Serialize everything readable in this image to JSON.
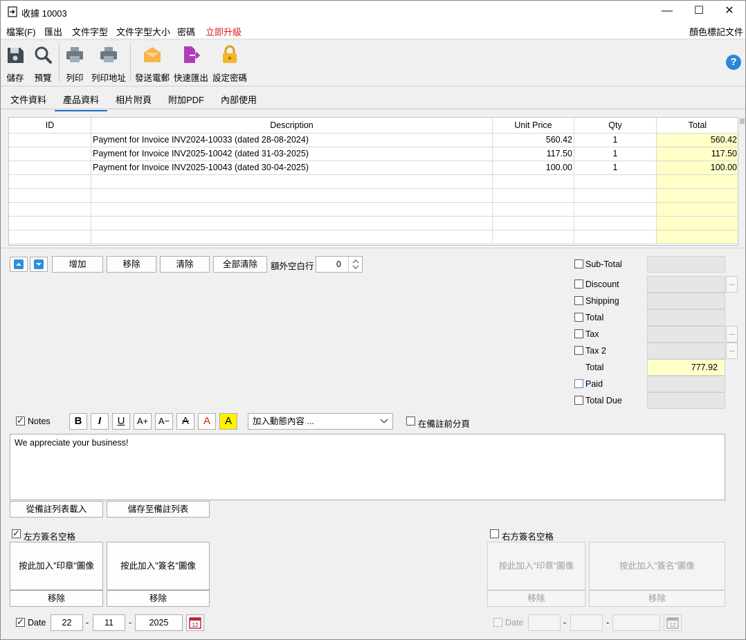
{
  "window": {
    "title": "收據 10003",
    "controls": {
      "minimize": "—",
      "maximize": "☐",
      "close": "✕"
    }
  },
  "menu": {
    "items": [
      "檔案(F)",
      "匯出",
      "文件字型",
      "文件字型大小",
      "密碼",
      "立即升級"
    ],
    "right": "顏色標記文件",
    "upgrade_color": "#e8141b"
  },
  "toolbar": {
    "save": "儲存",
    "preview": "預覽",
    "print": "列印",
    "print_address": "列印地址",
    "send_email": "發送電郵",
    "quick_export": "快速匯出",
    "set_password": "設定密碼",
    "help": "?"
  },
  "tabs": {
    "items": [
      "文件資料",
      "產品資料",
      "相片附頁",
      "附加PDF",
      "內部使用"
    ],
    "active": "產品資料"
  },
  "grid": {
    "headers": {
      "id": "ID",
      "description": "Description",
      "unit_price": "Unit Price",
      "qty": "Qty",
      "total": "Total"
    },
    "rows": [
      {
        "id": "",
        "description": "Payment for Invoice INV2024-10033 (dated 28-08-2024)",
        "unit_price": "560.42",
        "qty": "1",
        "total": "560.42"
      },
      {
        "id": "",
        "description": "Payment for Invoice INV2025-10042 (dated 31-03-2025)",
        "unit_price": "117.50",
        "qty": "1",
        "total": "117.50"
      },
      {
        "id": "",
        "description": "Payment for Invoice INV2025-10043 (dated 30-04-2025)",
        "unit_price": "100.00",
        "qty": "1",
        "total": "100.00"
      },
      {
        "id": "",
        "description": "",
        "unit_price": "",
        "qty": "",
        "total": ""
      },
      {
        "id": "",
        "description": "",
        "unit_price": "",
        "qty": "",
        "total": ""
      },
      {
        "id": "",
        "description": "",
        "unit_price": "",
        "qty": "",
        "total": ""
      },
      {
        "id": "",
        "description": "",
        "unit_price": "",
        "qty": "",
        "total": ""
      },
      {
        "id": "",
        "description": "",
        "unit_price": "",
        "qty": "",
        "total": ""
      }
    ]
  },
  "row_actions": {
    "add": "增加",
    "remove": "移除",
    "clear": "清除",
    "clear_all": "全部清除",
    "extra_blank_rows_label": "額外空白行",
    "extra_blank_rows_value": "0"
  },
  "summary": {
    "subtotal": {
      "label": "Sub-Total",
      "checked": false,
      "value": ""
    },
    "discount": {
      "label": "Discount",
      "checked": false,
      "value": ""
    },
    "shipping": {
      "label": "Shipping",
      "checked": false,
      "value": ""
    },
    "total_check": {
      "label": "Total",
      "checked": false,
      "value": ""
    },
    "tax": {
      "label": "Tax",
      "checked": false,
      "value": ""
    },
    "tax2": {
      "label": "Tax 2",
      "checked": false,
      "value": ""
    },
    "total": {
      "label": "Total",
      "value": "777.92"
    },
    "paid": {
      "label": "Paid",
      "checked": false,
      "value": ""
    },
    "total_due": {
      "label": "Total Due",
      "checked": false,
      "value": ""
    },
    "dots": "..."
  },
  "notes": {
    "label": "Notes",
    "checked": true,
    "format_buttons": {
      "bold": "B",
      "italic": "I",
      "underline": "U",
      "grow": "A+",
      "shrink": "A−",
      "strike": "A",
      "color": "A",
      "highlight": "A"
    },
    "dynamic_placeholder": "加入動態內容 ...",
    "page_break_label": "在備註前分頁",
    "text": "We appreciate your business!",
    "load_from_list": "從備註列表載入",
    "save_to_list": "儲存至備註列表"
  },
  "left_signature": {
    "label": "左方簽名空格",
    "checked": true,
    "stamp": "按此加入\"印章\"圖像",
    "signature": "按此加入\"簽名\"圖像",
    "remove1": "移除",
    "remove2": "移除",
    "date_label": "Date",
    "date_checked": true,
    "day": "22",
    "month": "11",
    "year": "2025",
    "sep": "-",
    "calendar_day": "12"
  },
  "right_signature": {
    "label": "右方簽名空格",
    "checked": false,
    "stamp": "按此加入\"印章\"圖像",
    "signature": "按此加入\"簽名\"圖像",
    "remove1": "移除",
    "remove2": "移除",
    "date_label": "Date",
    "date_checked": false,
    "sep": "-",
    "calendar_day": "12"
  }
}
